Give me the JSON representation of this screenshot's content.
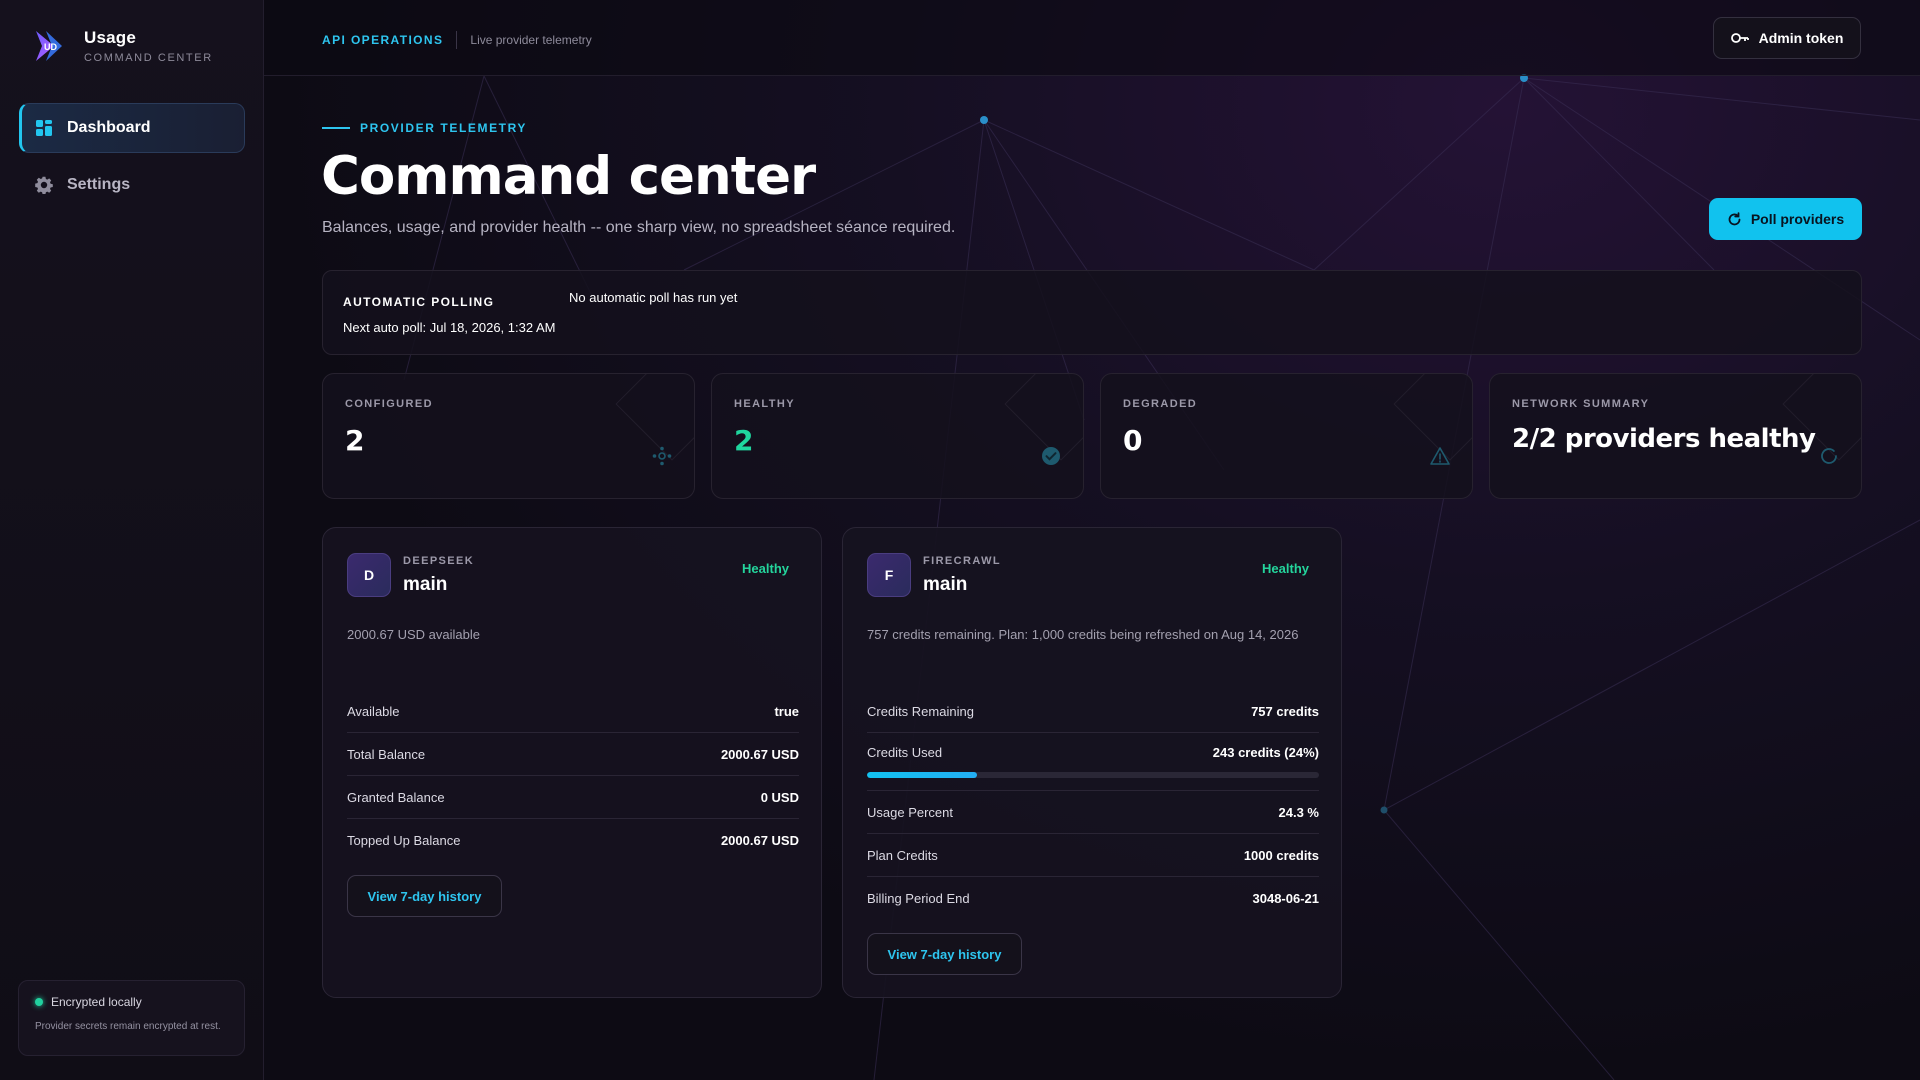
{
  "brand": {
    "name": "Usage",
    "subtitle": "COMMAND CENTER",
    "logo_text": "UD"
  },
  "sidebar": {
    "items": [
      {
        "label": "Dashboard",
        "icon": "grid-icon",
        "active": true
      },
      {
        "label": "Settings",
        "icon": "gear-icon",
        "active": false
      }
    ],
    "security": {
      "title": "Encrypted locally",
      "subtitle": "Provider secrets remain encrypted at rest."
    }
  },
  "topbar": {
    "section": "API OPERATIONS",
    "subsection": "Live provider telemetry",
    "admin_label": "Admin token"
  },
  "header": {
    "eyebrow": "PROVIDER TELEMETRY",
    "title": "Command center",
    "subtitle": "Balances, usage, and provider health -- one sharp view, no spreadsheet séance required.",
    "poll_label": "Poll providers"
  },
  "polling": {
    "label": "AUTOMATIC POLLING",
    "status": "No automatic poll has run yet",
    "next": "Next auto poll: Jul 18, 2026, 1:32 AM"
  },
  "stats": [
    {
      "label": "CONFIGURED",
      "value": "2",
      "icon": "network-icon"
    },
    {
      "label": "HEALTHY",
      "value": "2",
      "icon": "check-circle-icon"
    },
    {
      "label": "DEGRADED",
      "value": "0",
      "icon": "warning-icon"
    },
    {
      "label": "NETWORK SUMMARY",
      "value": "2/2 providers healthy",
      "icon": "refresh-icon"
    }
  ],
  "providers": [
    {
      "initial": "D",
      "provider": "DEEPSEEK",
      "name": "main",
      "status": "Healthy",
      "description": "2000.67 USD available",
      "rows": [
        {
          "key": "Available",
          "value": "true"
        },
        {
          "key": "Total Balance",
          "value": "2000.67 USD"
        },
        {
          "key": "Granted Balance",
          "value": "0 USD"
        },
        {
          "key": "Topped Up Balance",
          "value": "2000.67 USD"
        }
      ],
      "history_label": "View 7-day history"
    },
    {
      "initial": "F",
      "provider": "FIRECRAWL",
      "name": "main",
      "status": "Healthy",
      "description": "757 credits remaining. Plan: 1,000 credits being refreshed on Aug 14, 2026",
      "rows": [
        {
          "key": "Credits Remaining",
          "value": "757 credits"
        },
        {
          "key": "Credits Used",
          "value": "243 credits (24%)",
          "progress": 0.243
        },
        {
          "key": "Usage Percent",
          "value": "24.3 %"
        },
        {
          "key": "Plan Credits",
          "value": "1000 credits"
        },
        {
          "key": "Billing Period End",
          "value": "3048-06-21"
        }
      ],
      "history_label": "View 7-day history"
    }
  ],
  "colors": {
    "accent": "#11c2ee",
    "healthy": "#1fd69e",
    "background": "#0b0a12"
  }
}
